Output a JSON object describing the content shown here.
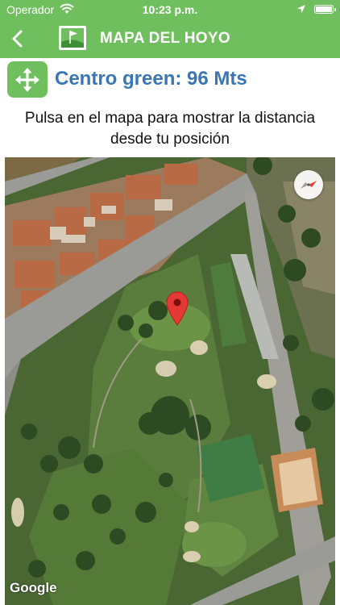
{
  "status_bar": {
    "carrier": "Operador",
    "time": "10:23 p.m."
  },
  "nav": {
    "title": "MAPA DEL HOYO"
  },
  "distance": {
    "label": "Centro green: 96 Mts"
  },
  "instructions": "Pulsa en el mapa para mostrar la distancia desde tu posición",
  "map": {
    "attribution": "Google"
  },
  "colors": {
    "brand_green": "#6fbf5e",
    "distance_blue": "#3a76b5",
    "pin_red": "#e53935"
  },
  "icons": {
    "back": "chevron-left",
    "logo": "golf-flag",
    "move": "four-way-arrows",
    "compass": "compass-needle",
    "pin": "map-marker"
  }
}
